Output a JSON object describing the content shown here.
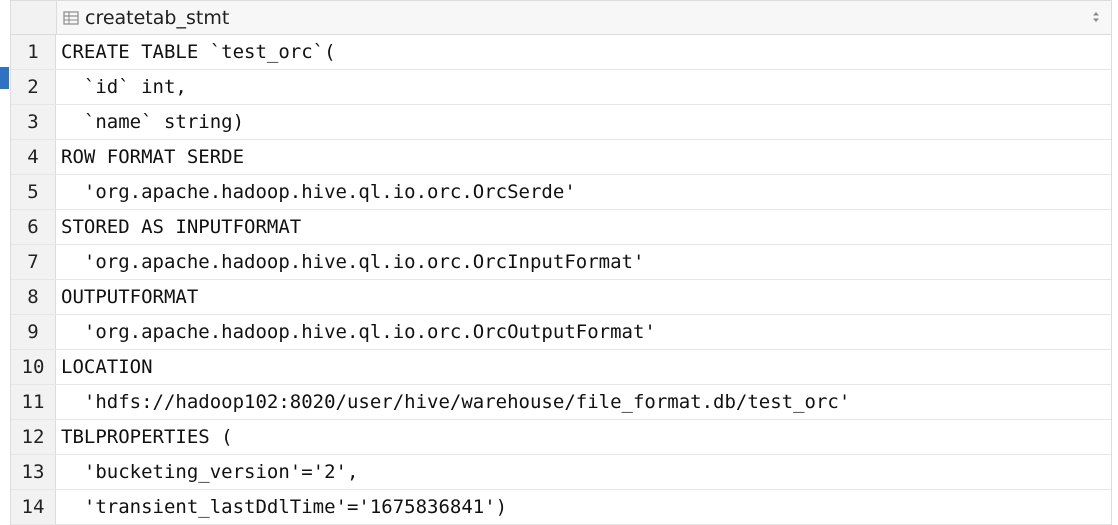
{
  "column": {
    "name": "createtab_stmt",
    "icon": "table-column-icon",
    "sort_icon": "sort-toggle-icon"
  },
  "rows": [
    {
      "num": "1",
      "text": "CREATE TABLE `test_orc`("
    },
    {
      "num": "2",
      "text": "  `id` int,"
    },
    {
      "num": "3",
      "text": "  `name` string)"
    },
    {
      "num": "4",
      "text": "ROW FORMAT SERDE"
    },
    {
      "num": "5",
      "text": "  'org.apache.hadoop.hive.ql.io.orc.OrcSerde'"
    },
    {
      "num": "6",
      "text": "STORED AS INPUTFORMAT"
    },
    {
      "num": "7",
      "text": "  'org.apache.hadoop.hive.ql.io.orc.OrcInputFormat'"
    },
    {
      "num": "8",
      "text": "OUTPUTFORMAT"
    },
    {
      "num": "9",
      "text": "  'org.apache.hadoop.hive.ql.io.orc.OrcOutputFormat'"
    },
    {
      "num": "10",
      "text": "LOCATION"
    },
    {
      "num": "11",
      "text": "  'hdfs://hadoop102:8020/user/hive/warehouse/file_format.db/test_orc'"
    },
    {
      "num": "12",
      "text": "TBLPROPERTIES ("
    },
    {
      "num": "13",
      "text": "  'bucketing_version'='2',"
    },
    {
      "num": "14",
      "text": "  'transient_lastDdlTime'='1675836841')"
    }
  ],
  "colors": {
    "accent_marker": "#2f72c4",
    "header_bg": "#f2f2f2",
    "grid_line": "#dcdcdc"
  }
}
